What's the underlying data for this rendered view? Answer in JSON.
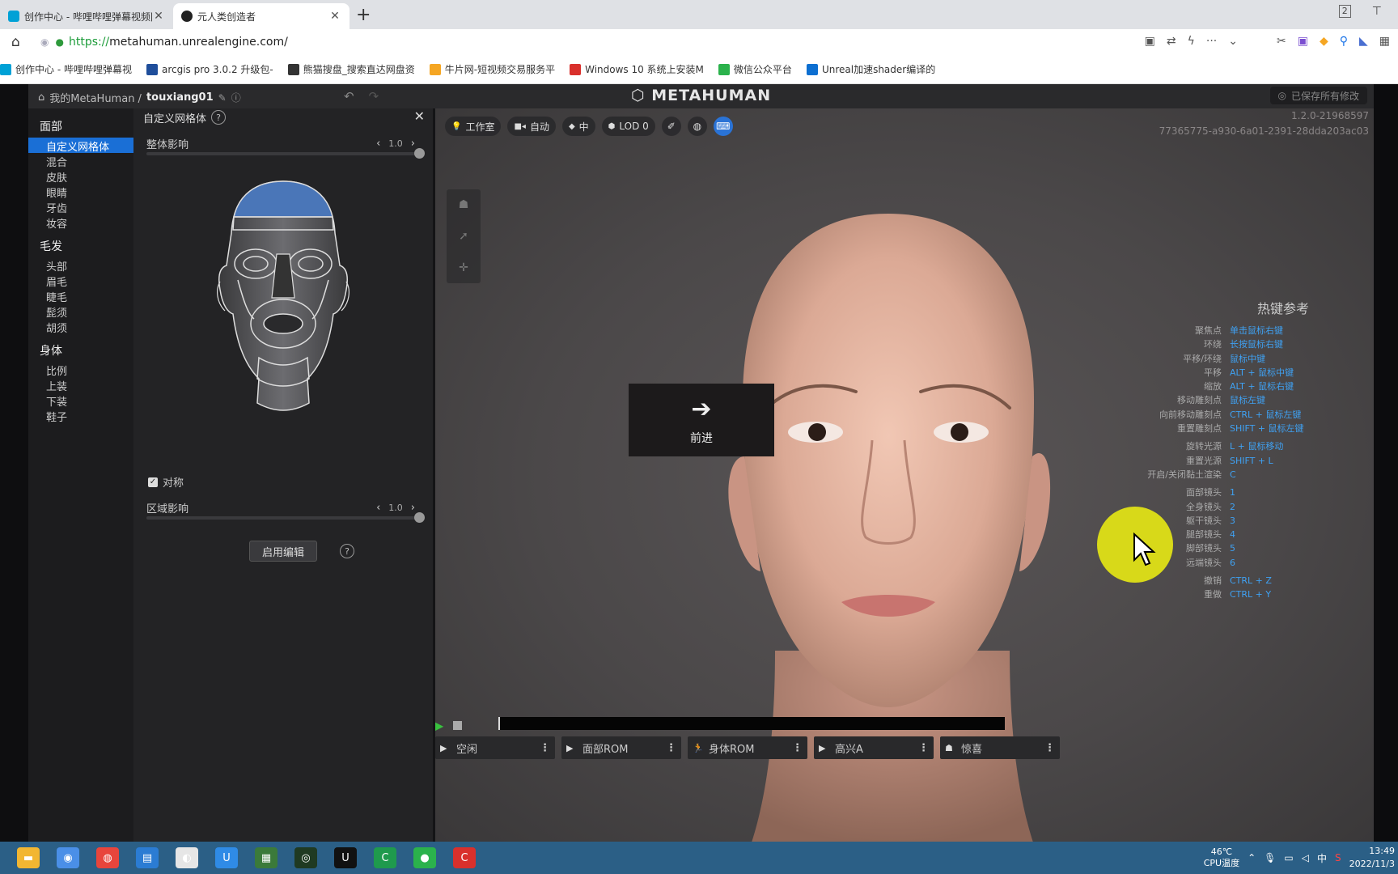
{
  "browser": {
    "tabs": [
      {
        "title": "创作中心 - 哔哩哔哩弹幕视频网",
        "active": false,
        "icon": "bilibili-icon"
      },
      {
        "title": "元人类创造者",
        "active": true,
        "icon": "unreal-icon"
      }
    ],
    "tab_badge": "2",
    "url_https": "https://",
    "url_rest": "metahuman.unrealengine.com/",
    "bookmarks": [
      {
        "label": "创作中心 - 哔哩哔哩弹幕视",
        "color": "#00a1d6"
      },
      {
        "label": "arcgis pro 3.0.2 升级包-",
        "color": "#1f4e9b"
      },
      {
        "label": "熊猫搜盘_搜索直达网盘资",
        "color": "#333333"
      },
      {
        "label": "牛片网-短视频交易服务平",
        "color": "#f5a623"
      },
      {
        "label": "Windows 10 系统上安装M",
        "color": "#d9302c"
      },
      {
        "label": "微信公众平台",
        "color": "#2bb24c"
      },
      {
        "label": "Unreal加速shader编译的",
        "color": "#0d6fd1"
      }
    ]
  },
  "app": {
    "breadcrumb_root": "我的MetaHuman /",
    "breadcrumb_name": "touxiang01",
    "logo": "METAHUMAN",
    "saved_status": "已保存所有修改",
    "nav": [
      {
        "head": "面部",
        "items": [
          "自定义网格体",
          "混合",
          "皮肤",
          "眼睛",
          "牙齿",
          "妆容"
        ]
      },
      {
        "head": "毛发",
        "items": [
          "头部",
          "眉毛",
          "睫毛",
          "髭须",
          "胡须"
        ]
      },
      {
        "head": "身体",
        "items": [
          "比例",
          "上装",
          "下装",
          "鞋子"
        ]
      }
    ],
    "selected_nav": "自定义网格体",
    "panel": {
      "title": "自定义网格体",
      "help": "?",
      "overall_label": "整体影响",
      "overall_value": "1.0",
      "overall_fraction": 1.0,
      "symmetry_label": "对称",
      "symmetry_checked": true,
      "region_label": "区域影响",
      "region_value": "1.0",
      "region_fraction": 1.0,
      "enable_button": "启用编辑"
    },
    "viewport": {
      "toolbar": [
        {
          "label": "工作室",
          "icon": "bulb-icon"
        },
        {
          "label": "自动",
          "icon": "camera-icon"
        },
        {
          "label": "中",
          "icon": "diamond-icon"
        },
        {
          "label": "LOD 0",
          "icon": "cube-icon"
        }
      ],
      "version": "1.2.0-21968597",
      "guid": "77365775-a930-6a01-2391-28dda203ac03",
      "forward_label": "前进",
      "hotkeys_title": "热键参考",
      "hotkeys": [
        {
          "k": "聚焦点",
          "v": "单击鼠标右键"
        },
        {
          "k": "环绕",
          "v": "长按鼠标右键"
        },
        {
          "k": "平移/环绕",
          "v": "鼠标中键"
        },
        {
          "k": "平移",
          "v": "ALT + 鼠标中键"
        },
        {
          "k": "缩放",
          "v": "ALT + 鼠标右键"
        },
        {
          "k": "移动雕刻点",
          "v": "鼠标左键"
        },
        {
          "k": "向前移动雕刻点",
          "v": "CTRL + 鼠标左键"
        },
        {
          "k": "重置雕刻点",
          "v": "SHIFT + 鼠标左键"
        },
        {
          "k": "旋转光源",
          "v": "L + 鼠标移动",
          "gap": true
        },
        {
          "k": "重置光源",
          "v": "SHIFT + L"
        },
        {
          "k": "开启/关闭黏土渲染",
          "v": "C"
        },
        {
          "k": "面部镜头",
          "v": "1",
          "gap": true
        },
        {
          "k": "全身镜头",
          "v": "2"
        },
        {
          "k": "躯干镜头",
          "v": "3"
        },
        {
          "k": "腿部镜头",
          "v": "4"
        },
        {
          "k": "脚部镜头",
          "v": "5"
        },
        {
          "k": "远端镜头",
          "v": "6"
        },
        {
          "k": "撤销",
          "v": "CTRL + Z",
          "gap": true
        },
        {
          "k": "重做",
          "v": "CTRL + Y"
        }
      ],
      "animations": [
        {
          "label": "空闲",
          "icon": "play-small-icon"
        },
        {
          "label": "面部ROM",
          "icon": "play-small-icon"
        },
        {
          "label": "身体ROM",
          "icon": "run-icon"
        },
        {
          "label": "高兴A",
          "icon": "play-small-icon"
        },
        {
          "label": "惊喜",
          "icon": "skull-icon"
        }
      ]
    }
  },
  "taskbar": {
    "apps": [
      {
        "name": "file-explorer-icon",
        "color": "#f2b632",
        "glyph": "▬"
      },
      {
        "name": "baidu-netdisk-icon",
        "color": "#4a8fe7",
        "glyph": "◉"
      },
      {
        "name": "chrome-icon",
        "color": "#e8453c",
        "glyph": "◍"
      },
      {
        "name": "word-doc-icon",
        "color": "#2b7cd3",
        "glyph": "▤"
      },
      {
        "name": "browser-icon",
        "color": "#e6e6e6",
        "glyph": "◐"
      },
      {
        "name": "uu-icon",
        "color": "#2f8be6",
        "glyph": "U"
      },
      {
        "name": "game-icon",
        "color": "#3b7a3a",
        "glyph": "▦"
      },
      {
        "name": "maps-icon",
        "color": "#1f3a22",
        "glyph": "◎"
      },
      {
        "name": "unreal-engine-icon",
        "color": "#111111",
        "glyph": "U"
      },
      {
        "name": "camtasia-icon",
        "color": "#1f9a4d",
        "glyph": "C"
      },
      {
        "name": "wechat-icon",
        "color": "#2bb24c",
        "glyph": "●"
      },
      {
        "name": "capcut-icon",
        "color": "#d9302c",
        "glyph": "C"
      }
    ],
    "temp": "46℃",
    "temp_label": "CPU温度",
    "ime": "中",
    "time": "13:49",
    "date": "2022/11/3"
  }
}
